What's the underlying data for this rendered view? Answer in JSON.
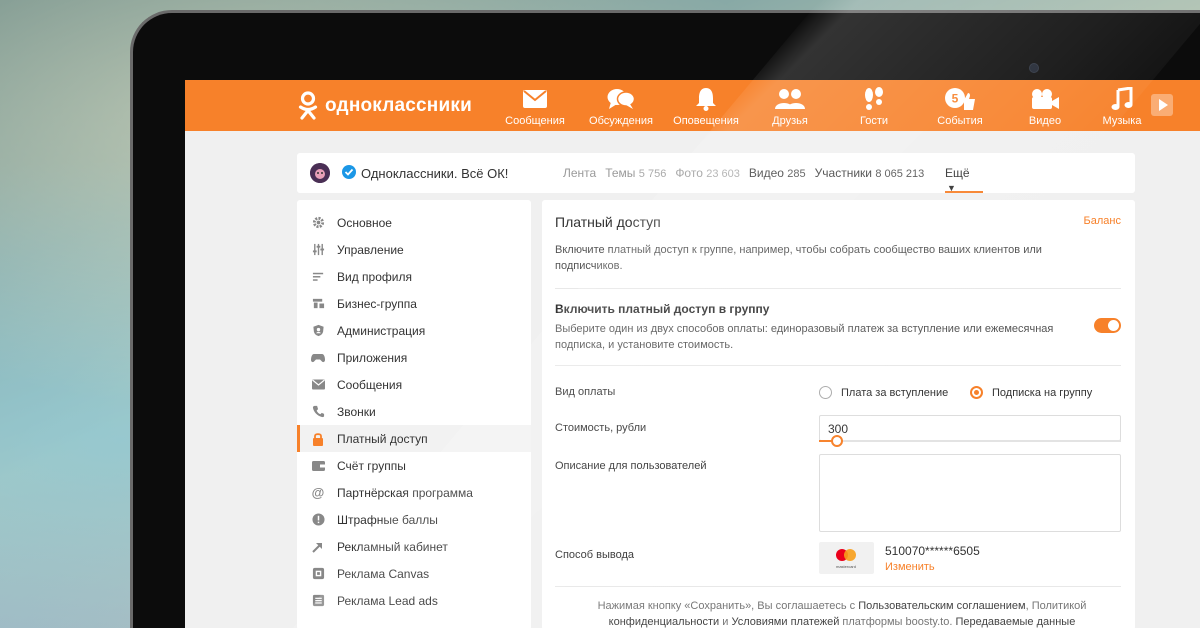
{
  "topbar": {
    "brand": "одноклассники",
    "nav": [
      {
        "label": "Сообщения",
        "icon": "envelope-icon"
      },
      {
        "label": "Обсуждения",
        "icon": "chat-bubbles-icon"
      },
      {
        "label": "Оповещения",
        "icon": "bell-icon"
      },
      {
        "label": "Друзья",
        "icon": "friends-icon"
      },
      {
        "label": "Гости",
        "icon": "footprints-icon"
      },
      {
        "label": "События",
        "icon": "like-five-icon",
        "badge": "5"
      },
      {
        "label": "Видео",
        "icon": "video-camera-icon"
      },
      {
        "label": "Музыка",
        "icon": "music-note-icon"
      }
    ]
  },
  "group": {
    "name": "Одноклассники. Всё ОК!",
    "tabs": [
      {
        "label": "Лента",
        "count": ""
      },
      {
        "label": "Темы",
        "count": "5 756"
      },
      {
        "label": "Фото",
        "count": "23 603"
      },
      {
        "label": "Видео",
        "count": "285"
      },
      {
        "label": "Участники",
        "count": "8 065 213"
      }
    ],
    "more": "Ещё"
  },
  "sidebar": {
    "items": [
      {
        "label": "Основное",
        "icon": "gear-icon"
      },
      {
        "label": "Управление",
        "icon": "sliders-icon"
      },
      {
        "label": "Вид профиля",
        "icon": "lines-icon"
      },
      {
        "label": "Бизнес-группа",
        "icon": "business-icon"
      },
      {
        "label": "Администрация",
        "icon": "shield-icon"
      },
      {
        "label": "Приложения",
        "icon": "gamepad-icon"
      },
      {
        "label": "Сообщения",
        "icon": "envelope-icon"
      },
      {
        "label": "Звонки",
        "icon": "phone-icon"
      },
      {
        "label": "Платный доступ",
        "icon": "lock-icon",
        "active": true
      },
      {
        "label": "Счёт группы",
        "icon": "wallet-icon"
      },
      {
        "label": "Партнёрская программа",
        "icon": "at-icon"
      },
      {
        "label": "Штрафные баллы",
        "icon": "warning-icon"
      },
      {
        "label": "Рекламный кабинет",
        "icon": "arrow-up-right-icon"
      },
      {
        "label": "Реклама Canvas",
        "icon": "canvas-icon"
      },
      {
        "label": "Реклама Lead ads",
        "icon": "list-box-icon"
      }
    ]
  },
  "main": {
    "title": "Платный доступ",
    "balance_link": "Баланс",
    "description": "Включите платный доступ к группе, например, чтобы собрать сообщество ваших клиентов или подписчиков.",
    "enable": {
      "title": "Включить платный доступ в группу",
      "description": "Выберите один из двух способов оплаты: единоразовый платеж за вступление или ежемесячная подписка, и установите стоимость.",
      "enabled": true
    },
    "payment_type": {
      "label": "Вид оплаты",
      "options": [
        "Плата за вступление",
        "Подписка на группу"
      ],
      "selected": "Подписка на группу"
    },
    "price": {
      "label": "Стоимость, рубли",
      "value": "300",
      "slider_fraction": 0.06
    },
    "user_description": {
      "label": "Описание для пользователей",
      "value": ""
    },
    "payout": {
      "label": "Способ вывода",
      "card_brand": "mastercard",
      "card_number": "510070******6505",
      "change_link": "Изменить"
    },
    "footer": {
      "p1": "Нажимая кнопку «Сохранить», Вы соглашаетесь с ",
      "link1": "Пользовательским соглашением",
      "p2": ", Политикой ",
      "link2": "конфиденциальности",
      "p3": " и ",
      "link3": "Условиями платежей",
      "p4": " платформы boosty.to. ",
      "p5": "Передаваемые данные"
    }
  },
  "colors": {
    "accent": "#f7812a",
    "verify": "#1b97e6"
  }
}
